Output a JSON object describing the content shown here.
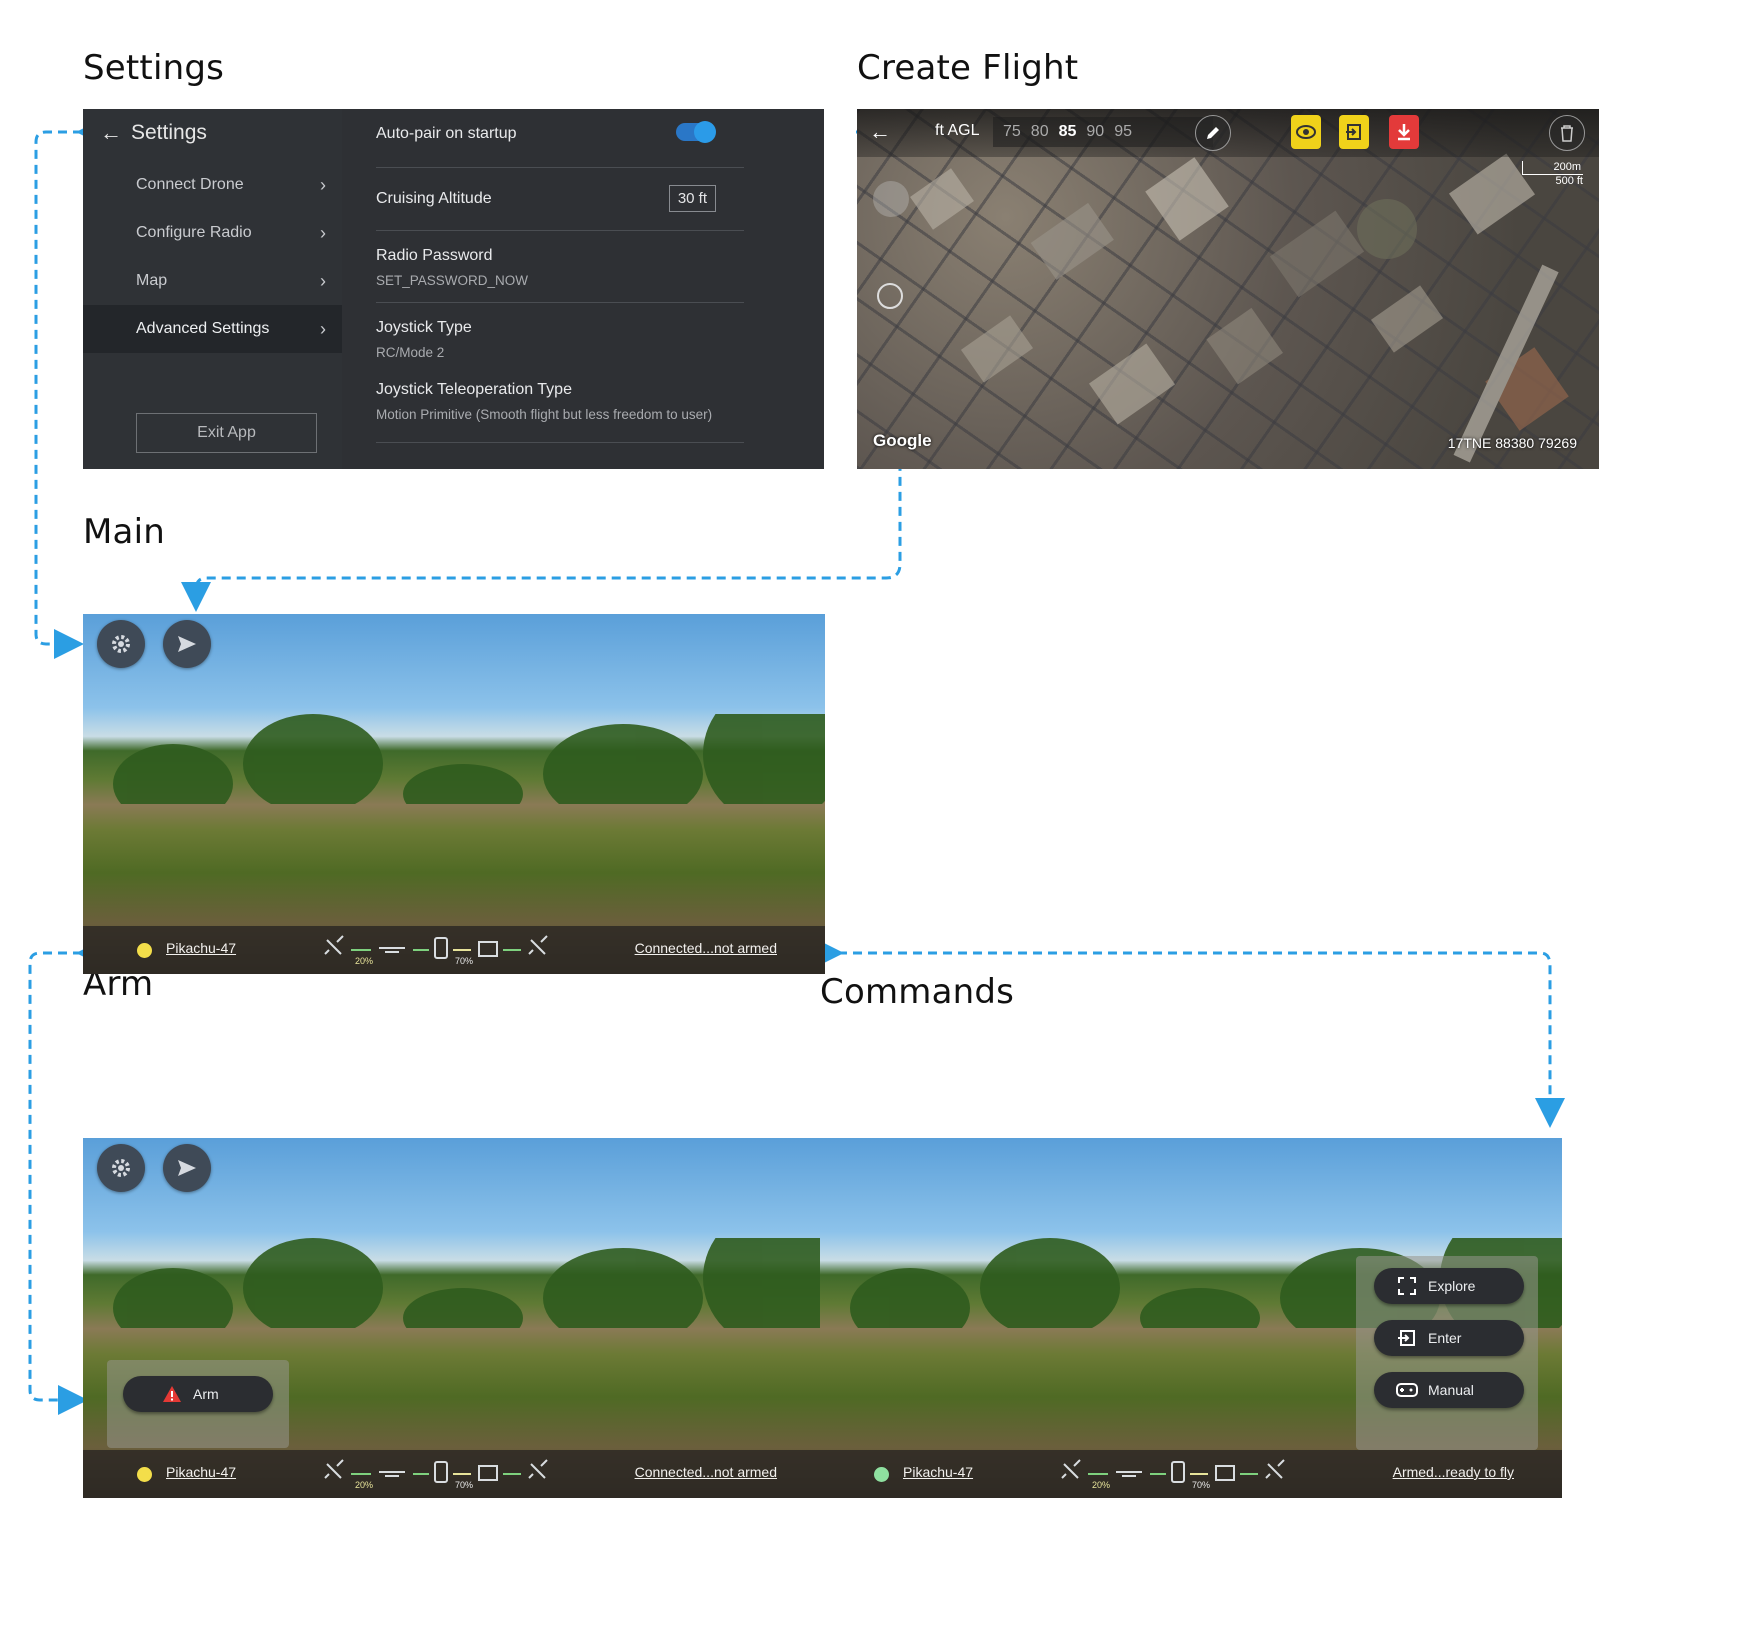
{
  "titles": {
    "settings": "Settings",
    "create_flight": "Create Flight",
    "main": "Main",
    "arm": "Arm",
    "commands": "Commands"
  },
  "settings": {
    "header": "Settings",
    "nav": [
      "Connect Drone",
      "Configure Radio",
      "Map",
      "Advanced Settings"
    ],
    "active_nav": "Advanced Settings",
    "exit_label": "Exit App",
    "rows": {
      "autopair": {
        "label": "Auto-pair on startup",
        "enabled": true
      },
      "cruising": {
        "label": "Cruising Altitude",
        "value": "30 ft"
      },
      "password": {
        "label": "Radio Password",
        "value": "SET_PASSWORD_NOW"
      },
      "joystick": {
        "label": "Joystick Type",
        "value": "RC/Mode 2"
      },
      "teleop": {
        "label": "Joystick Teleoperation Type",
        "value": "Motion Primitive (Smooth flight but less freedom to user)"
      }
    }
  },
  "create_flight": {
    "altitude_unit": "ft AGL",
    "altitudes": [
      "75",
      "80",
      "85",
      "90",
      "95"
    ],
    "selected_altitude": "85",
    "scale_metric": "200m",
    "scale_imperial": "500 ft",
    "attribution": "Google",
    "grid_ref": "17TNE 88380 79269",
    "icons": [
      "back-arrow-icon",
      "pencil-icon",
      "eye-icon",
      "enter-icon",
      "download-icon",
      "trash-icon"
    ],
    "badge_colors": {
      "eye": "#f0d21a",
      "enter": "#f0d21a",
      "download": "#e33a3a"
    }
  },
  "main": {
    "drone_name": "Pikachu-47",
    "status": "Connected...not armed",
    "status_color": "#f3de4a",
    "drone_battery": "20%",
    "controller_battery": "70%"
  },
  "arm": {
    "drone_name": "Pikachu-47",
    "status": "Connected...not armed",
    "status_color": "#f3de4a",
    "drone_battery": "20%",
    "controller_battery": "70%",
    "arm_label": "Arm"
  },
  "commands": {
    "drone_name": "Pikachu-47",
    "status": "Armed...ready to fly",
    "status_color": "#8fe0a0",
    "drone_battery": "20%",
    "controller_battery": "70%",
    "buttons": [
      "Explore",
      "Enter",
      "Manual"
    ]
  },
  "colors": {
    "accent": "#2b9be8",
    "connector": "#2b9ee3",
    "warning": "#e53935"
  }
}
